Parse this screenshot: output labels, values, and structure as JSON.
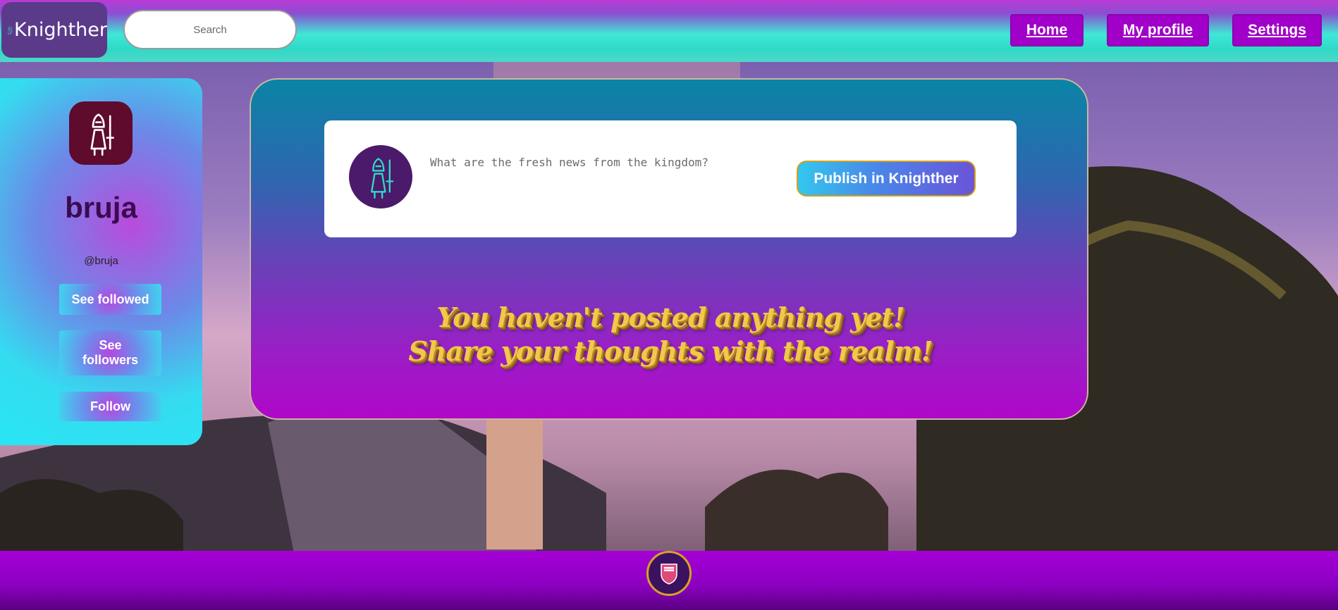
{
  "app": {
    "name": "Knighther"
  },
  "search": {
    "placeholder": "Search"
  },
  "nav": {
    "home": "Home",
    "my_profile": "My profile",
    "settings": "Settings"
  },
  "profile": {
    "username": "bruja",
    "handle": "@bruja",
    "see_followed": "See followed",
    "see_followers": "See followers",
    "follow": "Follow"
  },
  "composer": {
    "placeholder": "What are the fresh news from the kingdom?",
    "publish_label": "Publish in Knighther"
  },
  "feed": {
    "empty_line1": "You haven't posted anything yet!",
    "empty_line2": "Share your thoughts with the realm!"
  },
  "icons": {
    "logo": "knight-icon",
    "avatar": "knight-icon",
    "footer": "shield-badge-icon"
  },
  "colors": {
    "accent_purple": "#a000c8",
    "cyan": "#27e6f5",
    "gold": "#f2c84b"
  }
}
